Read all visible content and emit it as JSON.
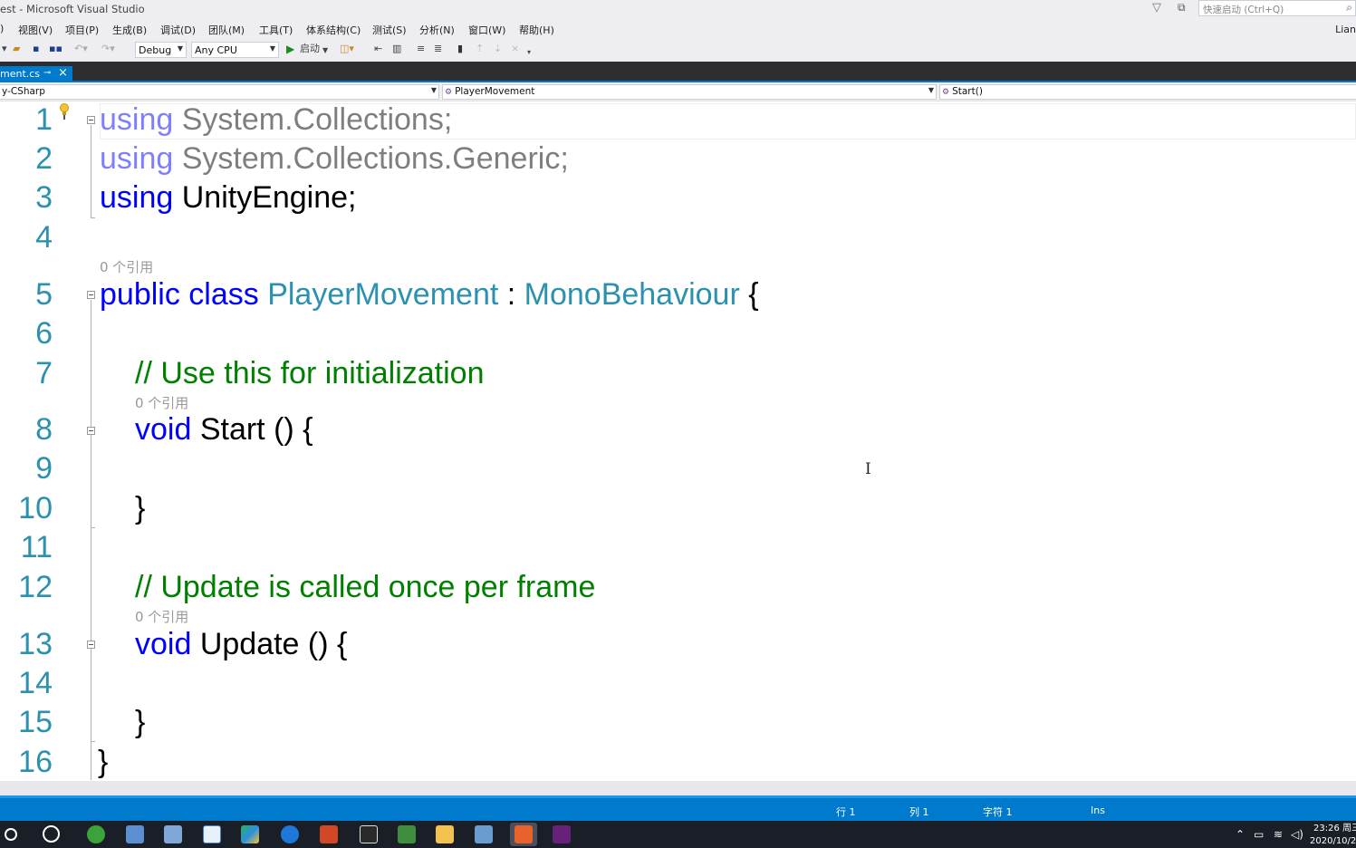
{
  "window": {
    "title": "est - Microsoft Visual Studio",
    "account": "Lian"
  },
  "quick_launch": {
    "placeholder": "快速启动 (Ctrl+Q)"
  },
  "menu": [
    "视图(V)",
    "项目(P)",
    "生成(B)",
    "调试(D)",
    "团队(M)",
    "工具(T)",
    "体系结构(C)",
    "测试(S)",
    "分析(N)",
    "窗口(W)",
    "帮助(H)"
  ],
  "toolbar": {
    "config": "Debug",
    "platform": "Any CPU",
    "start_label": "启动"
  },
  "doc_tab": {
    "label": "ment.cs"
  },
  "navbar": {
    "project": "y-CSharp",
    "class": "PlayerMovement",
    "member": "Start()"
  },
  "editor": {
    "line_numbers": [
      "1",
      "2",
      "3",
      "4",
      "5",
      "6",
      "7",
      "8",
      "9",
      "10",
      "11",
      "12",
      "13",
      "14",
      "15",
      "16"
    ],
    "code": {
      "l1_kw": "using",
      "l1_rest": " System.Collections;",
      "l2_kw": "using",
      "l2_rest": " System.Collections.Generic;",
      "l3_kw": "using",
      "l3_rest": " UnityEngine;",
      "l5_kw": "public class",
      "l5_name": " PlayerMovement",
      "l5_colon": " : ",
      "l5_base": "MonoBehaviour",
      "l5_brace": " {",
      "l7_comment": "// Use this for initialization",
      "l8_kw": "void",
      "l8_rest": " Start () {",
      "l10": "}",
      "l12_comment": "// Update is called once per frame",
      "l13_kw": "void",
      "l13_rest": " Update () {",
      "l15": "}",
      "l16": "}"
    },
    "codelens": {
      "class_refs": "0 个引用",
      "start_refs": "0 个引用",
      "update_refs": "0 个引用"
    }
  },
  "status": {
    "row": "行 1",
    "col": "列 1",
    "char": "字符 1",
    "mode": "Ins"
  },
  "taskbar": {
    "time": "23:26 周三",
    "date": "2020/10/2"
  },
  "colors": {
    "accent": "#007acc",
    "keyword": "#0000ff",
    "type": "#2b91af",
    "comment": "#008000"
  }
}
